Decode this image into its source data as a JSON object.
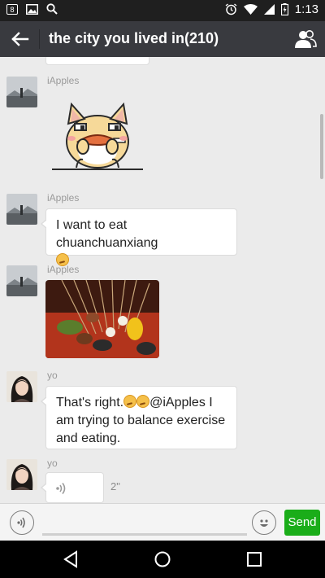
{
  "status_bar": {
    "time": "1:13",
    "left_icons": [
      "notification-count-icon",
      "gallery-icon",
      "search-icon"
    ],
    "notification_count": "8"
  },
  "app_bar": {
    "title": "the city you lived in(210)"
  },
  "messages": [
    {
      "sender": "iApples",
      "type": "sticker",
      "description": "cartoon-dog-eating-drumstick"
    },
    {
      "sender": "iApples",
      "type": "text",
      "text": "I want to eat chuanchuanxiang"
    },
    {
      "sender": "iApples",
      "type": "image",
      "description": "skewers-food-photo"
    },
    {
      "sender": "yo",
      "type": "text",
      "text_before": "That's right.",
      "text_after": "@iApples I am trying to balance exercise and eating."
    },
    {
      "sender": "yo",
      "type": "voice",
      "duration": "2\""
    }
  ],
  "input_bar": {
    "send_label": "Send",
    "placeholder": ""
  },
  "colors": {
    "app_bar": "#393a3f",
    "send_button": "#1aad19",
    "chat_background": "#ebebeb"
  }
}
